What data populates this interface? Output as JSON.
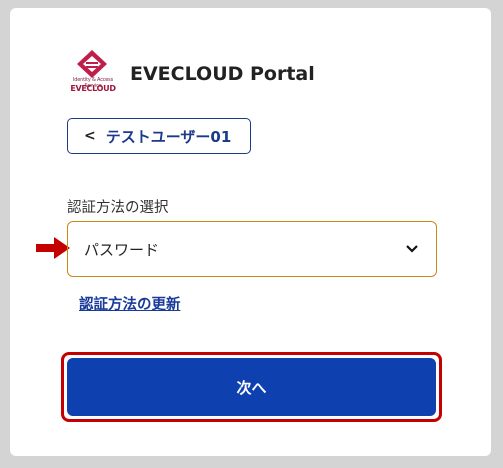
{
  "app": {
    "logo_tagline": "Identity & Access Service",
    "logo_text": "EVECLOUD",
    "title": "EVECLOUD Portal"
  },
  "user": {
    "name": "テストユーザー01"
  },
  "auth": {
    "label": "認証方法の選択",
    "selected": "パスワード",
    "update_link": "認証方法の更新"
  },
  "actions": {
    "next": "次へ"
  },
  "colors": {
    "primary": "#0e40b0",
    "highlight": "#c40000",
    "select_border": "#c98a1a",
    "brand": "#a0153e"
  },
  "icons": {
    "back": "chevron-left-icon",
    "dropdown": "chevron-down-icon",
    "pointer": "red-arrow-icon"
  }
}
